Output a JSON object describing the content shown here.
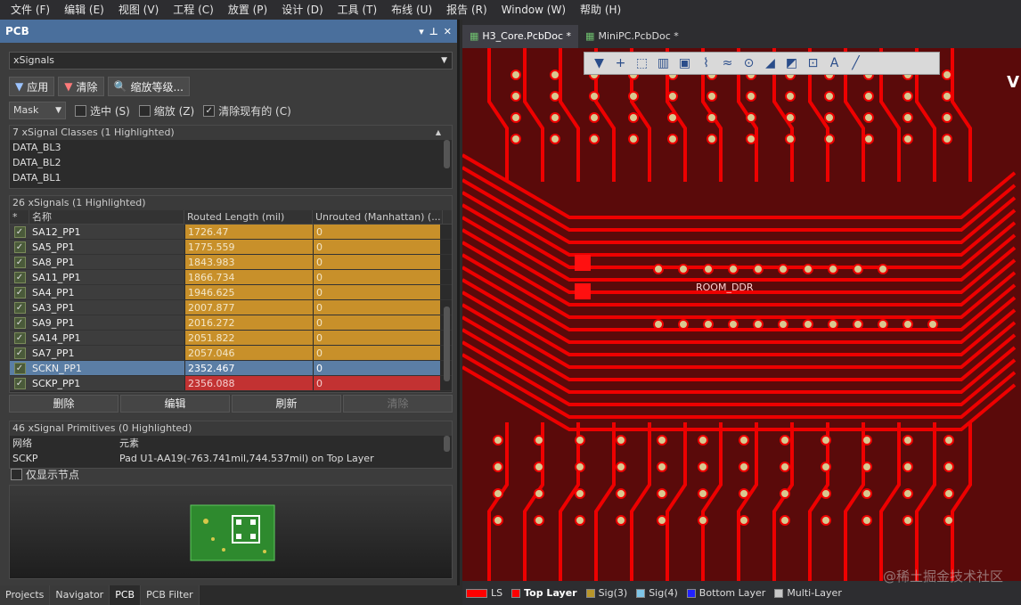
{
  "menu": [
    "文件 (F)",
    "编辑 (E)",
    "视图 (V)",
    "工程 (C)",
    "放置 (P)",
    "设计 (D)",
    "工具 (T)",
    "布线 (U)",
    "报告 (R)",
    "Window (W)",
    "帮助 (H)"
  ],
  "panel": {
    "title": "PCB",
    "filter_value": "xSignals",
    "buttons": {
      "apply": "应用",
      "clear": "清除",
      "zoom": "缩放等级..."
    },
    "mask_label": "Mask",
    "checks": {
      "select": "选中 (S)",
      "zoom": "缩放 (Z)",
      "clear_existing": "清除现有的 (C)"
    },
    "classes_header": "7 xSignal Classes (1 Highlighted)",
    "classes": [
      "DATA_BL3",
      "DATA_BL2",
      "DATA_BL1"
    ],
    "signals_header": "26 xSignals (1 Highlighted)",
    "columns": {
      "star": "*",
      "name": "名称",
      "routed": "Routed Length (mil)",
      "unrouted": "Unrouted (Manhattan) (..."
    },
    "signals": [
      {
        "name": "SA12_PP1",
        "length": "1726.47",
        "unrouted": "0"
      },
      {
        "name": "SA5_PP1",
        "length": "1775.559",
        "unrouted": "0"
      },
      {
        "name": "SA8_PP1",
        "length": "1843.983",
        "unrouted": "0"
      },
      {
        "name": "SA11_PP1",
        "length": "1866.734",
        "unrouted": "0"
      },
      {
        "name": "SA4_PP1",
        "length": "1946.625",
        "unrouted": "0"
      },
      {
        "name": "SA3_PP1",
        "length": "2007.877",
        "unrouted": "0"
      },
      {
        "name": "SA9_PP1",
        "length": "2016.272",
        "unrouted": "0"
      },
      {
        "name": "SA14_PP1",
        "length": "2051.822",
        "unrouted": "0"
      },
      {
        "name": "SA7_PP1",
        "length": "2057.046",
        "unrouted": "0"
      },
      {
        "name": "SCKN_PP1",
        "length": "2352.467",
        "unrouted": "0"
      },
      {
        "name": "SCKP_PP1",
        "length": "2356.088",
        "unrouted": "0"
      }
    ],
    "actions": {
      "delete": "删除",
      "edit": "编辑",
      "refresh": "刷新",
      "clear": "清除"
    },
    "primitives_header": "46 xSignal Primitives (0 Highlighted)",
    "primitive_columns": {
      "net": "网络",
      "element": "元素"
    },
    "primitive": {
      "net": "SCKP",
      "element": "Pad U1-AA19(-763.741mil,744.537mil) on Top Layer"
    },
    "only_nodes": "仅显示节点"
  },
  "bottom_tabs": [
    "Projects",
    "Navigator",
    "PCB",
    "PCB Filter"
  ],
  "doc_tabs": [
    "H3_Core.PcbDoc *",
    "MiniPC.PcbDoc *"
  ],
  "canvas_label": "ROOM_DDR",
  "layers": [
    "LS",
    "Top Layer",
    "Sig(3)",
    "Sig(4)",
    "Bottom Layer",
    "Multi-Layer"
  ],
  "layer_colors": [
    "#ff0000",
    "#ff0000",
    "#b8962a",
    "#7fc6e8",
    "#2222ff",
    "#c8c8c8"
  ],
  "watermark": "@稀土掘金技术社区",
  "right_letter": "V"
}
